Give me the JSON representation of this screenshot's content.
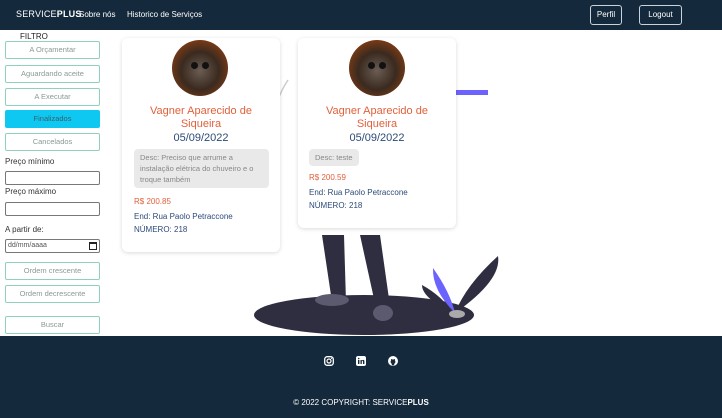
{
  "navbar": {
    "brand_prefix": "SERVICE",
    "brand_suffix": "PLUS",
    "links": [
      "Sobre nós",
      "Historico de Serviços"
    ],
    "profile_label": "Perfil",
    "logout_label": "Logout"
  },
  "filter": {
    "title": "FILTRO",
    "status_buttons": [
      "A Orçamentar",
      "Aguardando aceite",
      "A Executar",
      "Finalizados",
      "Cancelados"
    ],
    "active_status": "Finalizados",
    "min_price_label": "Preço mínimo",
    "max_price_label": "Preço máximo",
    "from_date_label": "A partir de:",
    "date_placeholder": "dd/mm/aaaa",
    "sort_asc_label": "Ordem crescente",
    "sort_desc_label": "Ordem decrescente",
    "search_label": "Buscar"
  },
  "cards": [
    {
      "name": "Vagner Aparecido de Siqueira",
      "date": "05/09/2022",
      "description": "Desc: Preciso que arrume a instalação elétrica do chuveiro e o troque também",
      "price": "R$ 200.85",
      "address": "End: Rua Paolo Petraccone",
      "number": "NÚMERO: 218"
    },
    {
      "name": "Vagner Aparecido de Siqueira",
      "date": "05/09/2022",
      "description": "Desc: teste",
      "price": "R$ 200.59",
      "address": "End: Rua Paolo Petraccone",
      "number": "NÚMERO: 218"
    }
  ],
  "footer": {
    "social_icons": [
      "instagram-icon",
      "linkedin-icon",
      "github-icon"
    ],
    "copyright_prefix": "© 2022 COPYRIGHT: SERVICE",
    "copyright_suffix": "PLUS"
  },
  "colors": {
    "navbar_bg": "#14293b",
    "active_filter": "#0fc8f2",
    "filter_border": "#8fd1c1",
    "name_color": "#e2603b",
    "date_color": "#2c4a78"
  }
}
